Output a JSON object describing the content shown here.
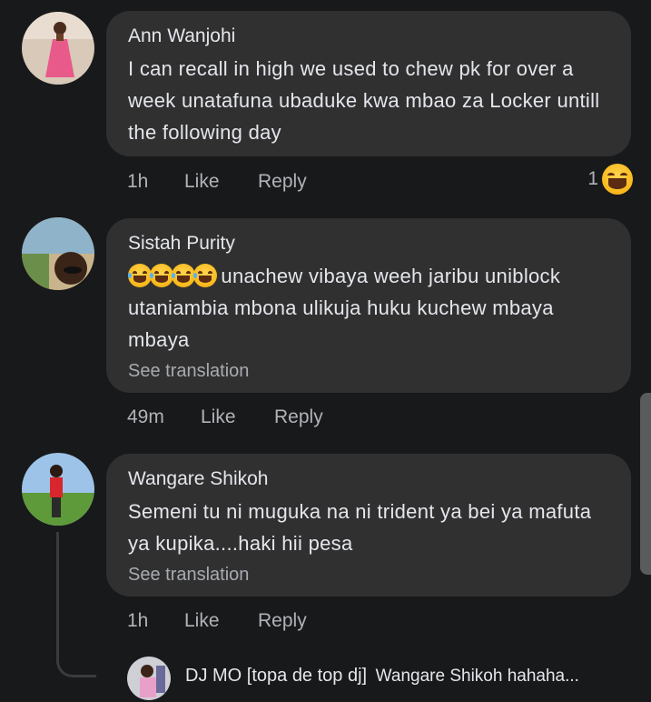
{
  "comments": [
    {
      "author": "Ann Wanjohi",
      "text": "I can recall in high we used to chew pk for over a week  unatafuna ubaduke kwa  mbao za Locker untill the following day",
      "time": "1h",
      "like": "Like",
      "reply": "Reply",
      "reaction_count": "1",
      "reaction_icon": "laughing-face-icon"
    },
    {
      "author": "Sistah Purity",
      "text": " unachew vibaya weeh jaribu uniblock utaniambia mbona ulikuja huku kuchew mbaya mbaya",
      "emoji_prefix": "rolling-on-floor-laughing x4",
      "see_translation": "See translation",
      "time": "49m",
      "like": "Like",
      "reply": "Reply"
    },
    {
      "author": "Wangare Shikoh",
      "text": "Semeni tu ni muguka na ni trident ya bei ya mafuta ya kupika....haki hii pesa",
      "see_translation": "See translation",
      "time": "1h",
      "like": "Like",
      "reply": "Reply"
    }
  ],
  "reply_preview": {
    "author": "DJ MO [topa de top dj]",
    "snippet": "Wangare Shikoh hahaha..."
  },
  "colors": {
    "background": "#18191a",
    "bubble": "#303031",
    "text": "#e4e6eb",
    "secondary": "#b0b3b8"
  }
}
